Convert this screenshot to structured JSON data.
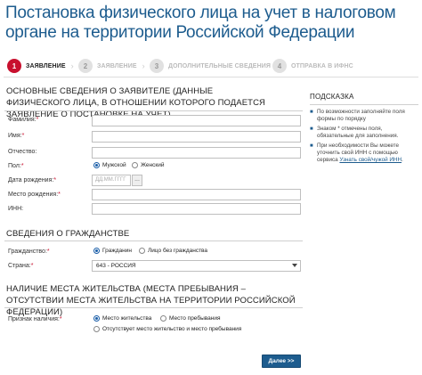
{
  "page": {
    "title": "Постановка физического лица на учет в налоговом органе на территории Российской Федерации"
  },
  "steps": [
    {
      "num": "1",
      "label": "ЗАЯВЛЕНИЕ",
      "active": true
    },
    {
      "num": "2",
      "label": "ЗАЯВЛЕНИЕ",
      "active": false
    },
    {
      "num": "3",
      "label": "ДОПОЛНИТЕЛЬНЫЕ СВЕДЕНИЯ",
      "active": false
    },
    {
      "num": "4",
      "label": "ОТПРАВКА В ИФНС",
      "active": false
    }
  ],
  "basic_section": {
    "heading": "ОСНОВНЫЕ СВЕДЕНИЯ О ЗАЯВИТЕЛЕ (ДАННЫЕ ФИЗИЧЕСКОГО ЛИЦА, В ОТНОШЕНИИ КОТОРОГО ПОДАЕТСЯ ЗАЯВЛЕНИЕ О ПОСТАНОВКЕ НА УЧЕТ)",
    "fields": {
      "surname": "Фамилия:",
      "name": "Имя:",
      "patronymic": "Отчество:",
      "sex": "Пол:",
      "birth_date": "Дата рождения:",
      "birth_place": "Место рождения:",
      "inn": "ИНН:"
    },
    "required_mark": "*",
    "sex_options": {
      "male": "Мужской",
      "female": "Женский"
    },
    "birth_date_placeholder": "ДД.ММ.ГГГГ",
    "date_button": "..."
  },
  "citizenship_section": {
    "heading": "СВЕДЕНИЯ О ГРАЖДАНСТВЕ",
    "citizenship_label": "Гражданство:",
    "citizenship_options": {
      "citizen": "Гражданин",
      "stateless": "Лицо без гражданства"
    },
    "country_label": "Страна:",
    "country_value": "643 - РОССИЯ"
  },
  "residence_section": {
    "heading": "НАЛИЧИЕ МЕСТА ЖИТЕЛЬСТВА (МЕСТА ПРЕБЫВАНИЯ – ОТСУТСТВИИ МЕСТА ЖИТЕЛЬСТВА НА ТЕРРИТОРИИ РОССИЙСКОЙ ФЕДЕРАЦИИ)",
    "sign_label": "Признак наличия:",
    "options": {
      "residence": "Место жительства",
      "stay": "Место пребывания",
      "none": "Отсутствует место жительство и место пребывания"
    }
  },
  "hint": {
    "title": "ПОДСКАЗКА",
    "items": [
      "По возможности заполняйте поля формы по порядку",
      "Знаком * отмечены поля, обязательные для заполнения.",
      "При необходимости Вы можете уточнить свой ИНН с помощью сервиса "
    ],
    "link": "Узнать свой/чужой ИНН",
    "link_tail": "."
  },
  "actions": {
    "next": "Далее >>"
  }
}
